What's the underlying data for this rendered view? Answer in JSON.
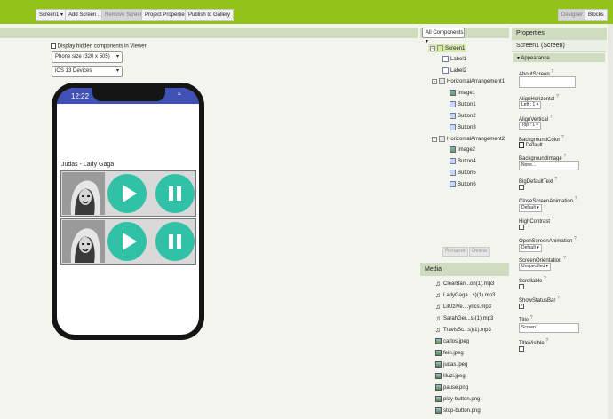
{
  "toolbar": {
    "screen_select": "Screen1 ▾",
    "add_screen": "Add Screen ...",
    "remove_screen": "Remove Screen",
    "project_properties": "Project Properties",
    "publish": "Publish to Gallery",
    "designer": "Designer",
    "blocks": "Blocks"
  },
  "viewer": {
    "hidden_components_label": "Display hidden components in Viewer",
    "phone_size": "Phone size (320 x 505)",
    "device": "iOS 13 Devices",
    "status_time": "12:22",
    "song_title": "Judas - Lady Gaga"
  },
  "components": {
    "dropdown": "All Components ▾",
    "tree": [
      {
        "label": "Screen1",
        "icon": "screen-icon"
      },
      {
        "label": "Label1",
        "icon": "label-icon"
      },
      {
        "label": "Label2",
        "icon": "label-icon"
      },
      {
        "label": "HorizontalArrangement1",
        "icon": "arrangement-icon"
      },
      {
        "label": "Image1",
        "icon": "image-icon"
      },
      {
        "label": "Button1",
        "icon": "button-icon"
      },
      {
        "label": "Button2",
        "icon": "button-icon"
      },
      {
        "label": "Button3",
        "icon": "button-icon"
      },
      {
        "label": "HorizontalArrangement2",
        "icon": "arrangement-icon"
      },
      {
        "label": "Image2",
        "icon": "image-icon"
      },
      {
        "label": "Button4",
        "icon": "button-icon"
      },
      {
        "label": "Button5",
        "icon": "button-icon"
      },
      {
        "label": "Button6",
        "icon": "button-icon"
      }
    ],
    "rename": "Rename",
    "delete": "Delete"
  },
  "media": {
    "title": "Media",
    "items": [
      {
        "label": "ClearBan...on(1).mp3",
        "icon": "audio-icon"
      },
      {
        "label": "LadyGaga...s)(1).mp3",
        "icon": "audio-icon"
      },
      {
        "label": "LilUziVe....yrics.mp3",
        "icon": "audio-icon"
      },
      {
        "label": "SarahGer...s)(1).mp3",
        "icon": "audio-icon"
      },
      {
        "label": "TravisSc...s)(1).mp3",
        "icon": "audio-icon"
      },
      {
        "label": "carlos.jpeg",
        "icon": "image-file-icon"
      },
      {
        "label": "fein.jpeg",
        "icon": "image-file-icon"
      },
      {
        "label": "judas.jpeg",
        "icon": "image-file-icon"
      },
      {
        "label": "liluzi.jpeg",
        "icon": "image-file-icon"
      },
      {
        "label": "pause.png",
        "icon": "image-file-icon"
      },
      {
        "label": "play-button.png",
        "icon": "image-file-icon"
      },
      {
        "label": "stop-button.png",
        "icon": "image-file-icon"
      }
    ]
  },
  "properties": {
    "title": "Properties",
    "component": "Screen1 (Screen)",
    "section": "▾ Appearance",
    "about_screen": "AboutScreen",
    "align_horizontal": "AlignHorizontal",
    "align_horizontal_value": "Left : 1 ▾",
    "align_vertical": "AlignVertical",
    "align_vertical_value": "Top : 1 ▾",
    "background_color": "BackgroundColor",
    "background_color_value": "Default",
    "background_image": "BackgroundImage",
    "background_image_value": "None...",
    "big_default_text": "BigDefaultText",
    "close_screen_animation": "CloseScreenAnimation",
    "close_screen_animation_value": "Default ▾",
    "high_contrast": "HighContrast",
    "open_screen_animation": "OpenScreenAnimation",
    "open_screen_animation_value": "Default ▾",
    "screen_orientation": "ScreenOrientation",
    "screen_orientation_value": "Unspecified ▾",
    "scrollable": "Scrollable",
    "show_status_bar": "ShowStatusBar",
    "title_label": "Title",
    "title_value": "Screen1",
    "title_visible": "TitleVisible",
    "help_mark": "?"
  },
  "colors": {
    "toolbar": "#93c21a",
    "status_bar": "#3f51b5",
    "button_circle": "#30c1a6"
  }
}
